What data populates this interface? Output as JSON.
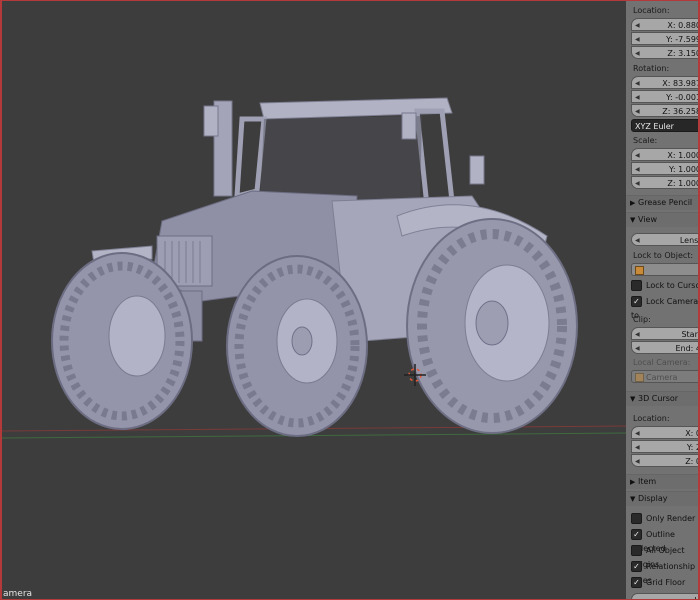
{
  "viewport": {
    "view_label": "amera"
  },
  "panel": {
    "location_label": "Location:",
    "location": {
      "x": "X: 0.880",
      "y": "Y: -7.599",
      "z": "Z: 3.150"
    },
    "rotation_label": "Rotation:",
    "rotation": {
      "x": "X: 83.987",
      "y": "Y: -0.001",
      "z": "Z: 36.258"
    },
    "rotation_mode": "XYZ Euler",
    "scale_label": "Scale:",
    "scale": {
      "x": "X: 1.000",
      "y": "Y: 1.000",
      "z": "Z: 1.000"
    },
    "grease_pencil": "Grease Pencil",
    "view_header": "View",
    "lens": "Lens:",
    "lock_to_object_label": "Lock to Object:",
    "lock_to_cursor": "Lock to Cursor",
    "lock_camera": "Lock Camera to",
    "clip_label": "Clip:",
    "clip_start": "Start",
    "clip_end": "End: 4",
    "local_camera_label": "Local Camera:",
    "local_camera_value": "Camera",
    "cursor_header": "3D Cursor",
    "cursor_location_label": "Location:",
    "cursor": {
      "x": "X: 0",
      "y": "Y: 2",
      "z": "Z: 0"
    },
    "item_header": "Item",
    "display_header": "Display",
    "only_render": "Only Render",
    "outline_selected": "Outline Selected",
    "all_object_origins": "All Object Origins",
    "relationship_lines": "Relationship Lines",
    "grid_floor": "Grid Floor",
    "last_field": "Li"
  },
  "colors": {
    "viewport_bg": "#3d3d3d",
    "panel_bg": "#727272",
    "model": "#9c9db3",
    "active_border": "#b33a3a"
  }
}
